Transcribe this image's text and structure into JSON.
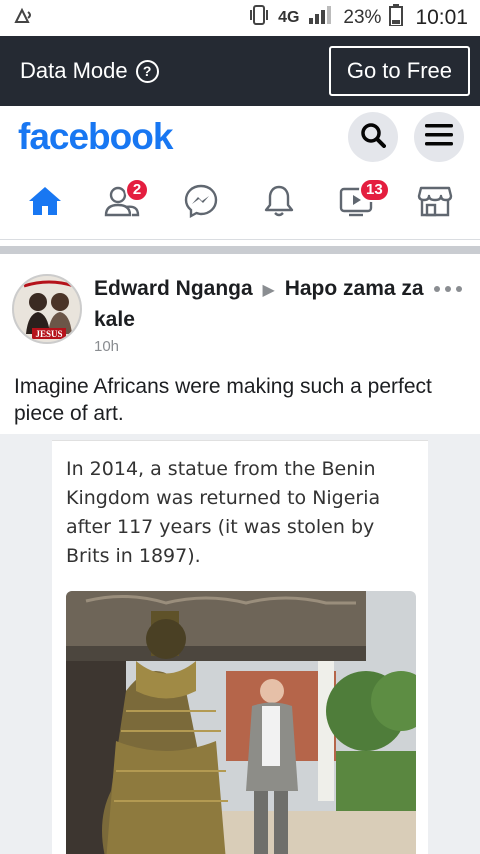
{
  "status_bar": {
    "network": "4G",
    "battery": "23%",
    "time": "10:01"
  },
  "data_mode": {
    "label": "Data Mode",
    "help_icon": "question-circle-icon",
    "button": "Go to Free"
  },
  "header": {
    "logo": "facebook"
  },
  "nav": {
    "friends_badge": "2",
    "watch_badge": "13"
  },
  "post": {
    "author": "Edward Nganga",
    "group": "Hapo zama za kale",
    "time": "10h",
    "text": "Imagine Africans were making such a perfect piece of art.",
    "caption": "In 2014, a statue from the Benin Kingdom was returned to Nigeria after 117 years (it was stolen by Brits in 1897).",
    "avatar_text": "JESUS"
  },
  "colors": {
    "brand": "#1877f2",
    "badge": "#e41e3f",
    "data_bar": "#252a33"
  }
}
